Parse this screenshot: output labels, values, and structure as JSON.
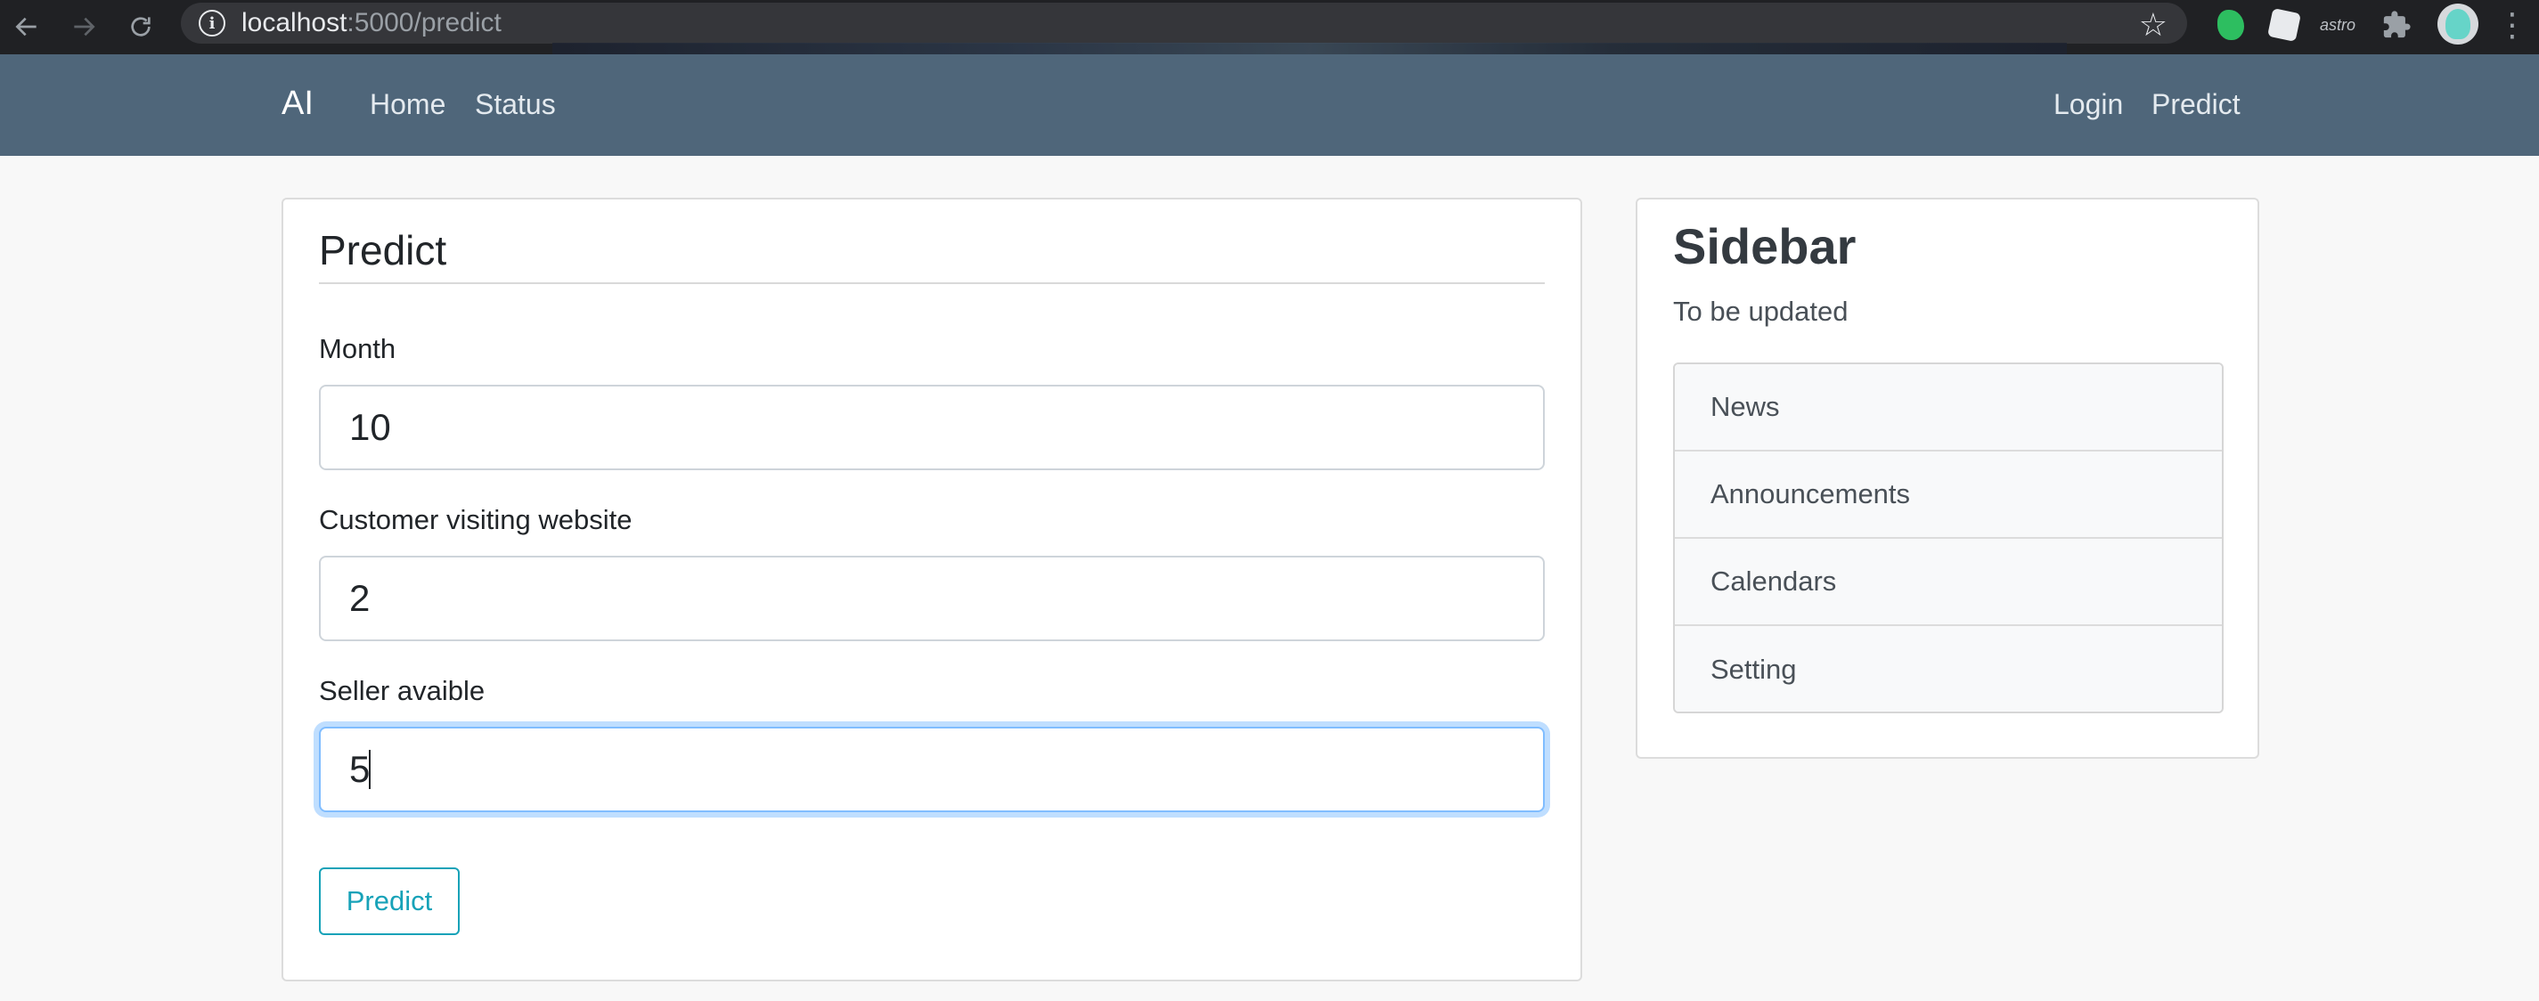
{
  "browser": {
    "url_host": "localhost",
    "url_rest": ":5000/predict",
    "extension_label_astro": "astro"
  },
  "navbar": {
    "brand": "AI",
    "left_links": [
      "Home",
      "Status"
    ],
    "right_links": [
      "Login",
      "Predict"
    ]
  },
  "form": {
    "title": "Predict",
    "fields": [
      {
        "label": "Month",
        "value": "10"
      },
      {
        "label": "Customer visiting website",
        "value": "2"
      },
      {
        "label": "Seller avaible",
        "value": "5"
      }
    ],
    "submit_label": "Predict"
  },
  "sidebar": {
    "title": "Sidebar",
    "subtitle": "To be updated",
    "items": [
      {
        "label": "News"
      },
      {
        "label": "Announcements"
      },
      {
        "label": "Calendars"
      },
      {
        "label": "Setting"
      }
    ]
  },
  "colors": {
    "navbar_bg": "#4f667a",
    "button_accent": "#17a2b8",
    "focus_ring": "#80bdff"
  }
}
